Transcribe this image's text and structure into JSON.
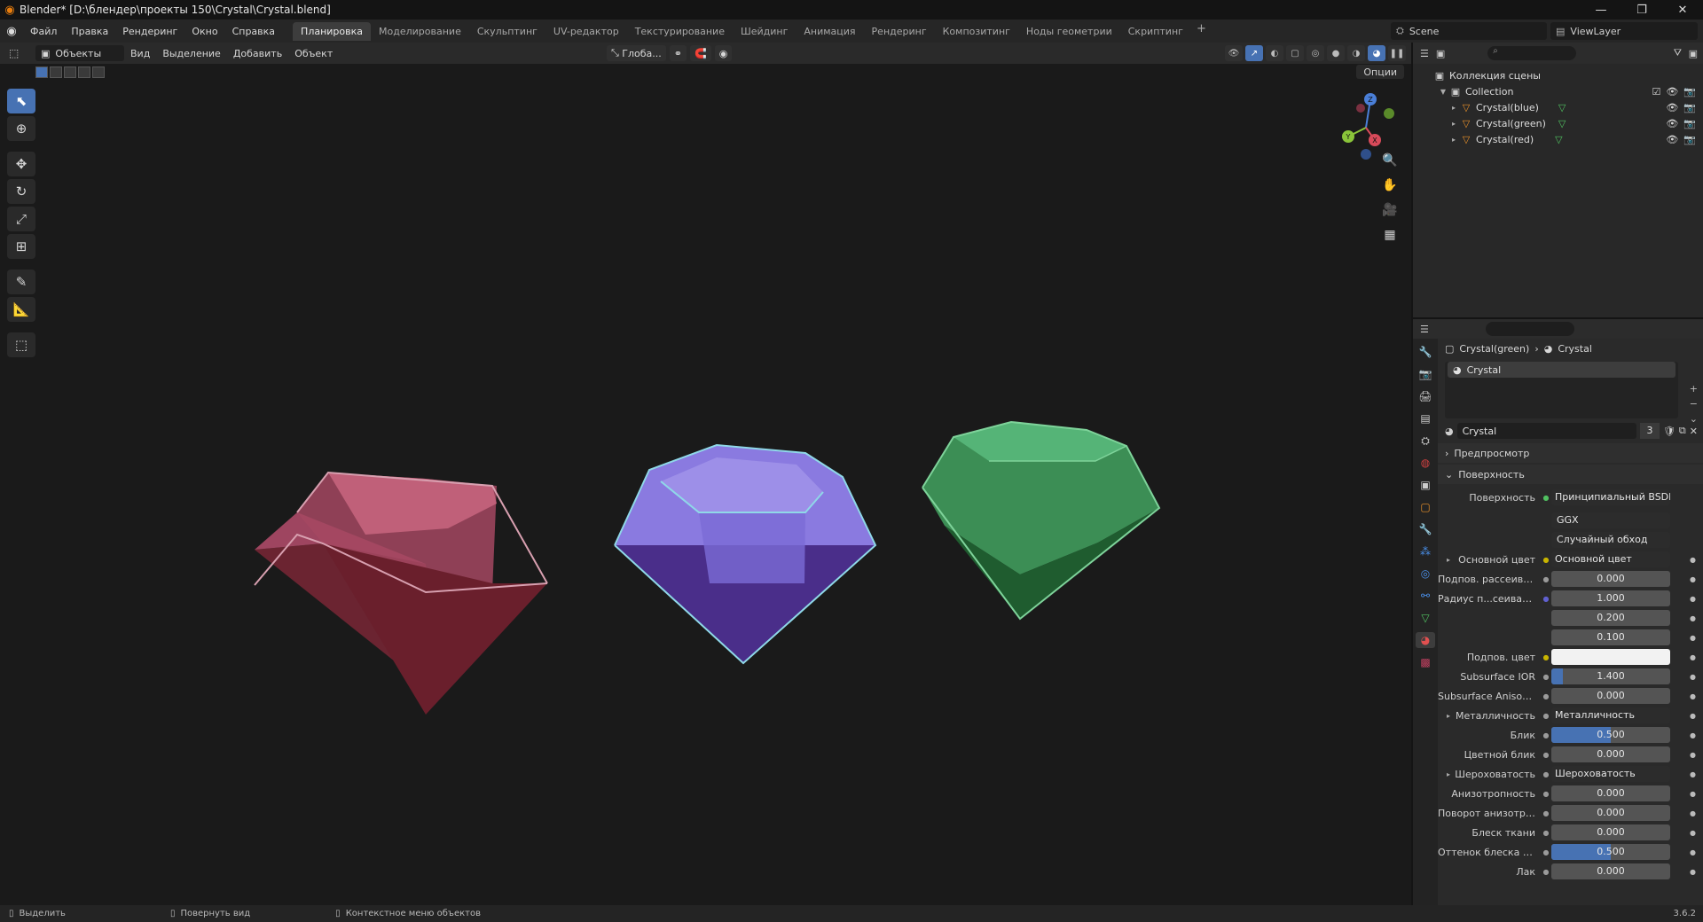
{
  "window": {
    "title": "Blender* [D:\\блендер\\проекты 150\\Crystal\\Crystal.blend]",
    "controls": [
      "—",
      "❐",
      "✕"
    ]
  },
  "menubar": {
    "menus": [
      "Файл",
      "Правка",
      "Рендеринг",
      "Окно",
      "Справка"
    ],
    "workspaces": [
      "Планировка",
      "Моделирование",
      "Скульптинг",
      "UV-редактор",
      "Текстурирование",
      "Шейдинг",
      "Анимация",
      "Рендеринг",
      "Композитинг",
      "Ноды геометрии",
      "Скриптинг"
    ],
    "active_workspace": "Планировка",
    "add_label": "+",
    "scene": "Scene",
    "view_layer": "ViewLayer"
  },
  "viewport": {
    "mode": "Объекты",
    "menus": [
      "Вид",
      "Выделение",
      "Добавить",
      "Объект"
    ],
    "transform_orientation": "Глоба...",
    "options_label": "Опции",
    "gizmo_axes": [
      "X",
      "Y",
      "Z"
    ],
    "objects": [
      {
        "name": "Crystal(red)",
        "color": "#b0455a"
      },
      {
        "name": "Crystal(blue)",
        "color": "#7b5fd0"
      },
      {
        "name": "Crystal(green)",
        "color": "#3f9a5a"
      }
    ]
  },
  "outliner": {
    "root": "Коллекция сцены",
    "collection": "Collection",
    "items": [
      {
        "label": "Crystal(blue)"
      },
      {
        "label": "Crystal(green)"
      },
      {
        "label": "Crystal(red)"
      }
    ]
  },
  "properties": {
    "breadcrumb_object": "Crystal(green)",
    "breadcrumb_material": "Crystal",
    "slot_name": "Crystal",
    "material_name": "Crystal",
    "user_count": "3",
    "panels": {
      "preview": "Предпросмотр",
      "surface": "Поверхность"
    },
    "surface_label": "Поверхность",
    "surface_shader": "Принципиальный BSDF",
    "distribution": "GGX",
    "subsurface_method": "Случайный обход",
    "rows": [
      {
        "label": "Основной цвет",
        "value": "Основной цвет",
        "kind": "link",
        "expand": true,
        "dot": "#c8b400"
      },
      {
        "label": "Подпов. рассеива...",
        "value": "0.000",
        "kind": "num",
        "dot": "#9a9a9a"
      },
      {
        "label": "Радиус п...сеивания",
        "value": "1.000",
        "kind": "num",
        "dot": "#6060d0"
      },
      {
        "label": "",
        "value": "0.200",
        "kind": "num",
        "dot": ""
      },
      {
        "label": "",
        "value": "0.100",
        "kind": "num",
        "dot": ""
      },
      {
        "label": "Подпов. цвет",
        "value": "",
        "kind": "color",
        "dot": "#c8b400"
      },
      {
        "label": "Subsurface IOR",
        "value": "1.400",
        "kind": "num",
        "fill": 0.1,
        "dot": "#9a9a9a"
      },
      {
        "label": "Subsurface Anisotr...",
        "value": "0.000",
        "kind": "num",
        "dot": "#9a9a9a"
      },
      {
        "label": "Металличность",
        "value": "Металличность",
        "kind": "link",
        "expand": true,
        "dot": "#9a9a9a"
      },
      {
        "label": "Блик",
        "value": "0.500",
        "kind": "num",
        "fill": 0.5,
        "dot": "#9a9a9a"
      },
      {
        "label": "Цветной блик",
        "value": "0.000",
        "kind": "num",
        "dot": "#9a9a9a"
      },
      {
        "label": "Шероховатость",
        "value": "Шероховатость",
        "kind": "link",
        "expand": true,
        "dot": "#9a9a9a"
      },
      {
        "label": "Анизотропность",
        "value": "0.000",
        "kind": "num",
        "dot": "#9a9a9a"
      },
      {
        "label": "Поворот анизотро...",
        "value": "0.000",
        "kind": "num",
        "dot": "#9a9a9a"
      },
      {
        "label": "Блеск ткани",
        "value": "0.000",
        "kind": "num",
        "dot": "#9a9a9a"
      },
      {
        "label": "Оттенок блеска тк...",
        "value": "0.500",
        "kind": "num",
        "fill": 0.5,
        "dot": "#9a9a9a"
      },
      {
        "label": "Лак",
        "value": "0.000",
        "kind": "num",
        "dot": "#9a9a9a"
      }
    ]
  },
  "statusbar": {
    "hints": [
      "Выделить",
      "Повернуть вид",
      "Контекстное меню объектов"
    ],
    "version": "3.6.2"
  }
}
